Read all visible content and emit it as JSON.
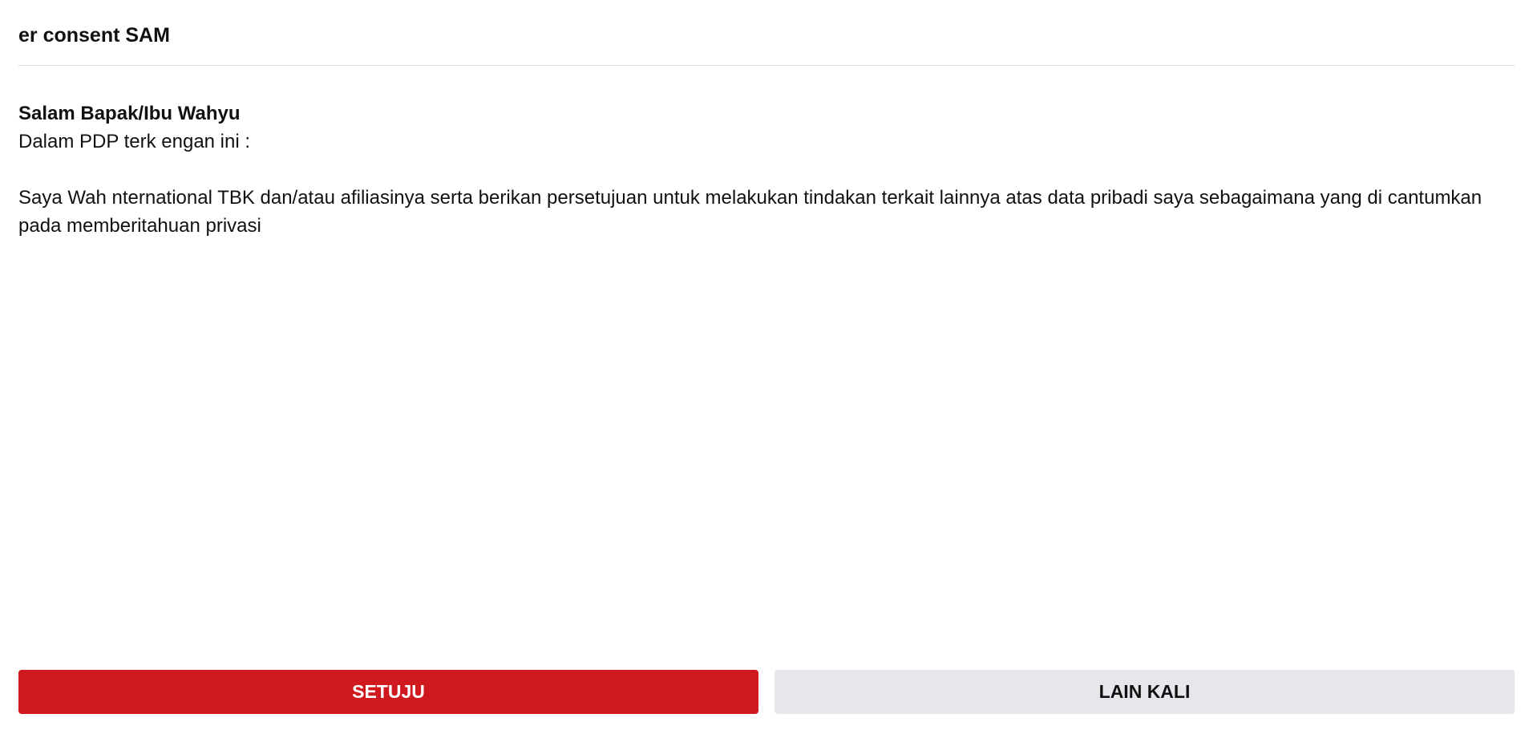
{
  "header": {
    "title": "er consent SAM"
  },
  "message": {
    "greeting": "Salam Bapak/Ibu Wahyu",
    "intro": "Dalam PDP terk engan ini :",
    "statement": "Saya Wah nternational TBK dan/atau afiliasinya serta berikan persetujuan untuk melakukan tindakan terkait lainnya atas data pribadi saya sebagaimana yang di cantumkan pada memberitahuan privasi"
  },
  "actions": {
    "agree_label": "SETUJU",
    "later_label": "LAIN KALI"
  },
  "colors": {
    "primary": "#d0181f",
    "secondary": "#e6e7eb",
    "divider": "#dcdcdc"
  }
}
